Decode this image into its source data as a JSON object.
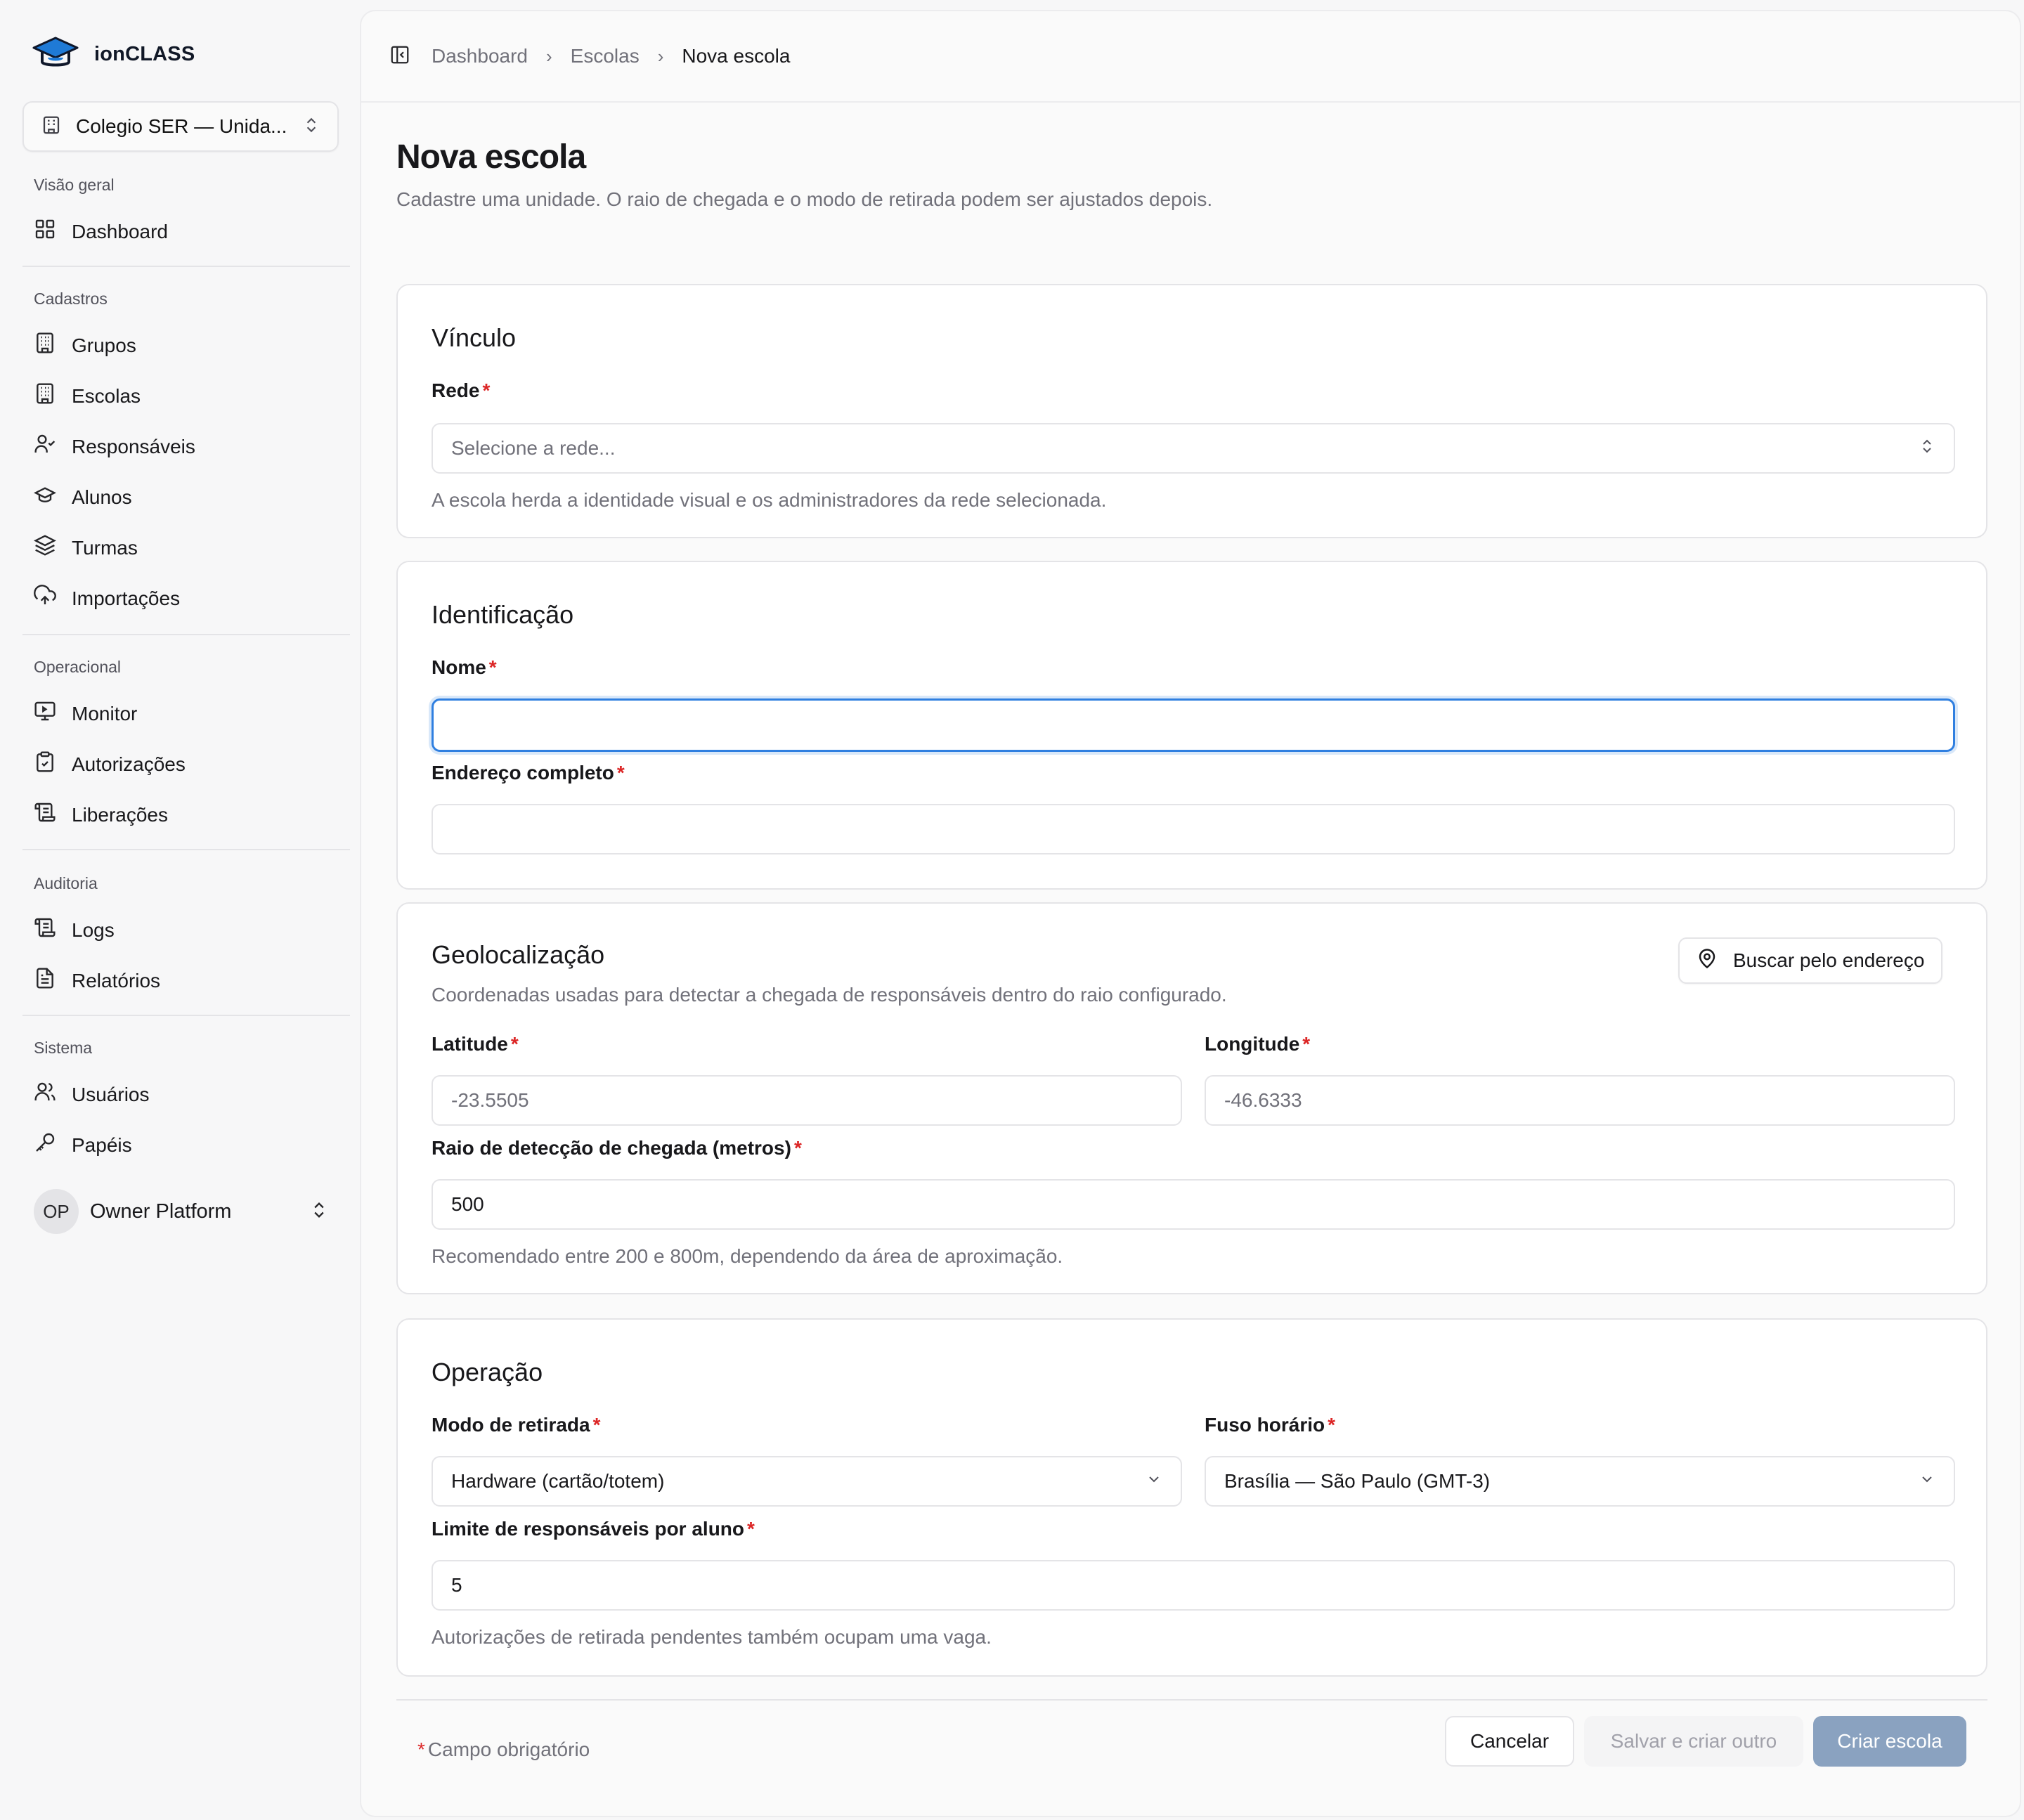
{
  "brand": {
    "name": "ionCLASS"
  },
  "tenant": {
    "label": "Colegio SER — Unida..."
  },
  "sidebar": {
    "sections": [
      {
        "title": "Visão geral",
        "items": [
          {
            "label": "Dashboard",
            "icon": "grid-icon"
          }
        ]
      },
      {
        "title": "Cadastros",
        "items": [
          {
            "label": "Grupos",
            "icon": "building-icon"
          },
          {
            "label": "Escolas",
            "icon": "building-icon"
          },
          {
            "label": "Responsáveis",
            "icon": "user-check-icon"
          },
          {
            "label": "Alunos",
            "icon": "graduation-cap-icon"
          },
          {
            "label": "Turmas",
            "icon": "layers-icon"
          },
          {
            "label": "Importações",
            "icon": "cloud-upload-icon"
          }
        ]
      },
      {
        "title": "Operacional",
        "items": [
          {
            "label": "Monitor",
            "icon": "monitor-icon"
          },
          {
            "label": "Autorizações",
            "icon": "clipboard-check-icon"
          },
          {
            "label": "Liberações",
            "icon": "scroll-icon"
          }
        ]
      },
      {
        "title": "Auditoria",
        "items": [
          {
            "label": "Logs",
            "icon": "scroll-icon"
          },
          {
            "label": "Relatórios",
            "icon": "file-text-icon"
          }
        ]
      },
      {
        "title": "Sistema",
        "items": [
          {
            "label": "Usuários",
            "icon": "users-icon"
          },
          {
            "label": "Papéis",
            "icon": "key-icon"
          }
        ]
      }
    ],
    "user": {
      "initials": "OP",
      "name": "Owner Platform"
    }
  },
  "breadcrumb": [
    "Dashboard",
    "Escolas",
    "Nova escola"
  ],
  "page": {
    "title": "Nova escola",
    "subtitle": "Cadastre uma unidade. O raio de chegada e o modo de retirada podem ser ajustados depois."
  },
  "vinculo": {
    "title": "Vínculo",
    "rede_label": "Rede",
    "rede_placeholder": "Selecione a rede...",
    "help": "A escola herda a identidade visual e os administradores da rede selecionada."
  },
  "identificacao": {
    "title": "Identificação",
    "nome_label": "Nome",
    "nome_value": "",
    "endereco_label": "Endereço completo",
    "endereco_value": ""
  },
  "geo": {
    "title": "Geolocalização",
    "subtitle": "Coordenadas usadas para detectar a chegada de responsáveis dentro do raio configurado.",
    "search_button": "Buscar pelo endereço",
    "lat_label": "Latitude",
    "lat_placeholder": "-23.5505",
    "lng_label": "Longitude",
    "lng_placeholder": "-46.6333",
    "radius_label": "Raio de detecção de chegada (metros)",
    "radius_value": "500",
    "help": "Recomendado entre 200 e 800m, dependendo da área de aproximação."
  },
  "operacao": {
    "title": "Operação",
    "modo_label": "Modo de retirada",
    "modo_value": "Hardware (cartão/totem)",
    "fuso_label": "Fuso horário",
    "fuso_value": "Brasília — São Paulo (GMT-3)",
    "limite_label": "Limite de responsáveis por aluno",
    "limite_value": "5",
    "help": "Autorizações de retirada pendentes também ocupam uma vaga."
  },
  "footer": {
    "required_note": "Campo obrigatório",
    "cancel": "Cancelar",
    "save_new": "Salvar e criar outro",
    "create": "Criar escola"
  },
  "colors": {
    "accent": "#2f7fe0",
    "required": "#dc2626",
    "primary_disabled": "#8aa2c0",
    "logo": "#1f7ad6"
  }
}
